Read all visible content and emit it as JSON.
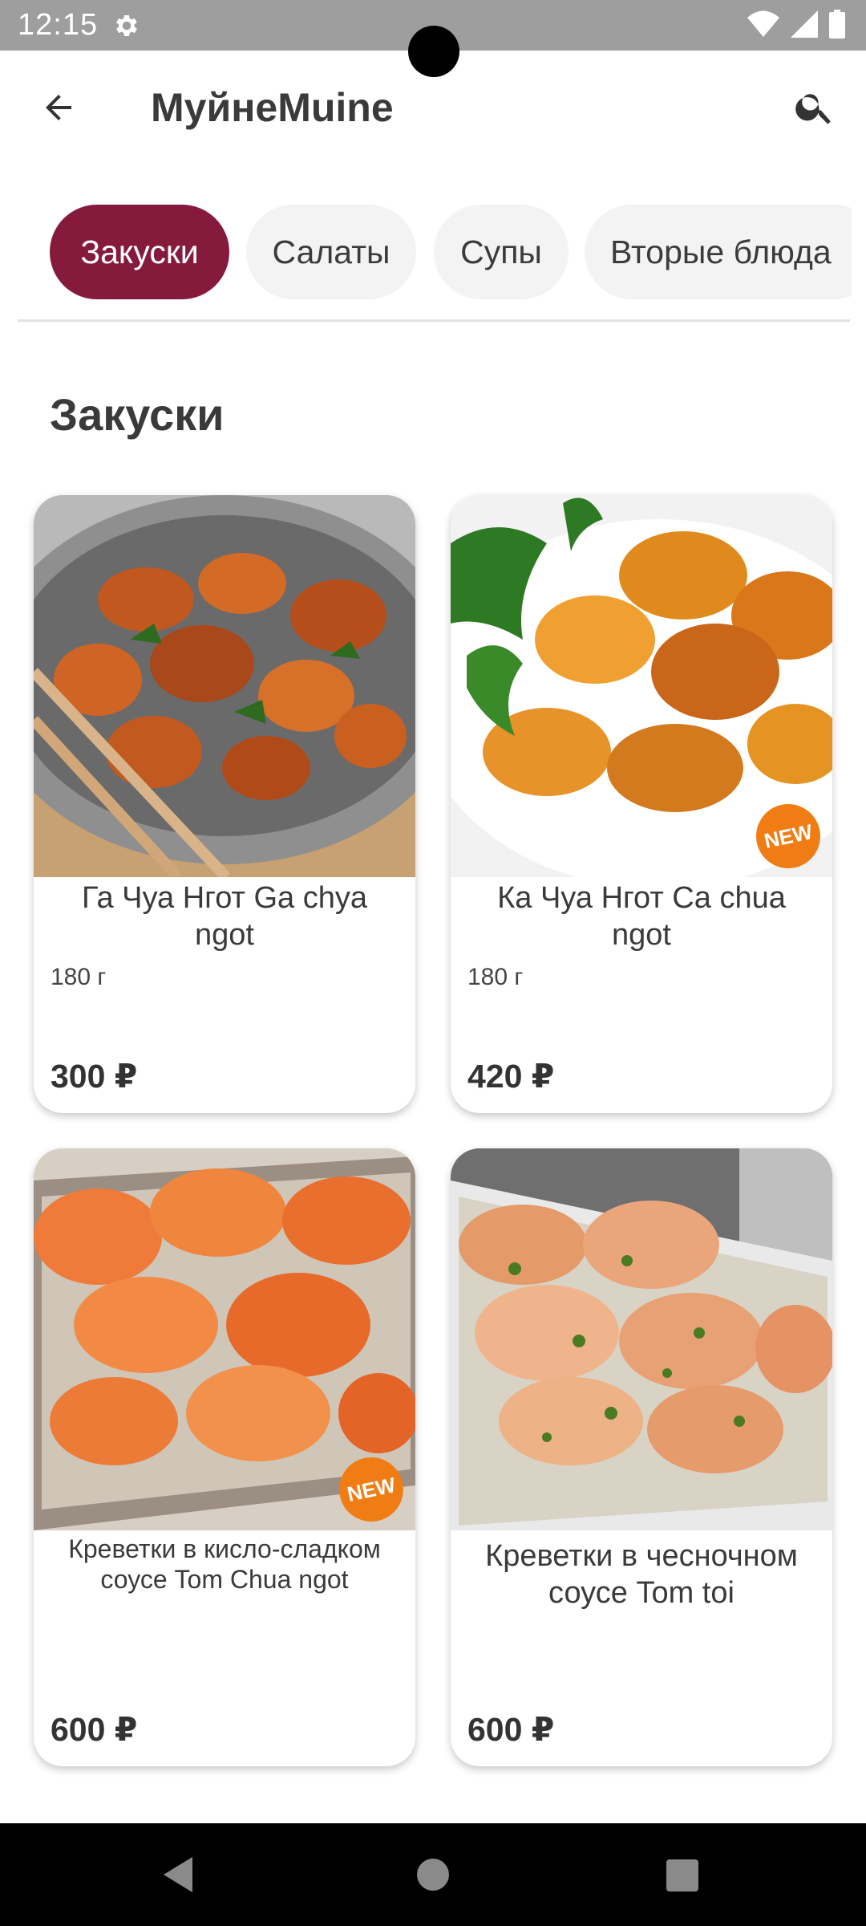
{
  "status_bar": {
    "time": "12:15",
    "icons": [
      "gear-icon",
      "wifi-icon",
      "signal-icon",
      "battery-icon"
    ]
  },
  "app_bar": {
    "title": "МуйнеMuine",
    "back_icon": "arrow-back-icon",
    "search_icon": "search-icon"
  },
  "tabs": [
    {
      "label": "Закуски",
      "active": true
    },
    {
      "label": "Салаты",
      "active": false
    },
    {
      "label": "Супы",
      "active": false
    },
    {
      "label": "Вторые блюда",
      "active": false
    }
  ],
  "section": {
    "title": "Закуски"
  },
  "products": [
    {
      "name": "Га Чуа Нгот Ga chya ngot",
      "weight": "180 г",
      "price": "300 ₽",
      "is_new": false
    },
    {
      "name": "Ка Чуа Нгот Ca chua ngot",
      "weight": "180 г",
      "price": "420 ₽",
      "is_new": true,
      "badge": "NEW"
    },
    {
      "name": "Креветки в кисло-сладком соусе Tom Chua ngot",
      "weight": "",
      "price": "600 ₽",
      "is_new": true,
      "badge": "NEW"
    },
    {
      "name": "Креветки в чесночном соусе Tom toi",
      "weight": "",
      "price": "600 ₽",
      "is_new": false
    }
  ],
  "colors": {
    "accent": "#861a3c",
    "tab_inactive_bg": "#f3f3f3",
    "badge": "#f07d14",
    "status_bar": "#9e9e9e",
    "nav_bar": "#000000"
  }
}
